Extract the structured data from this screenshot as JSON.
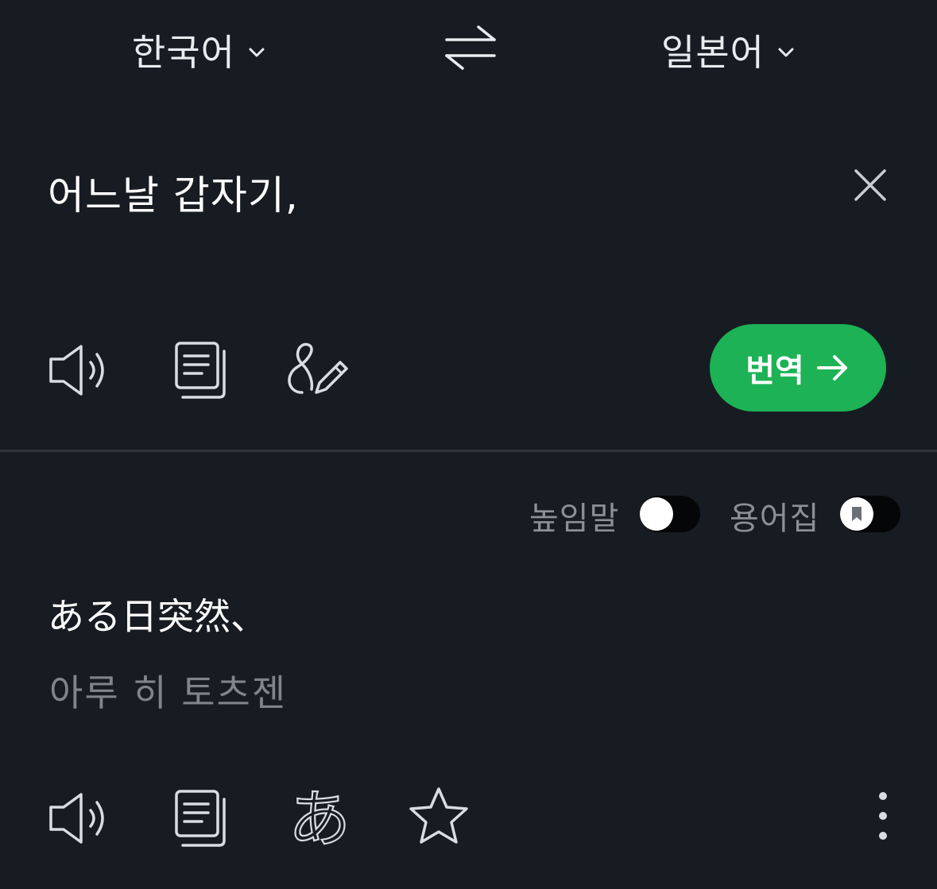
{
  "header": {
    "source_lang": "한국어",
    "target_lang": "일본어"
  },
  "input": {
    "text": "어느날 갑자기,"
  },
  "actions": {
    "translate_label": "번역"
  },
  "options": {
    "honorific_label": "높임말",
    "honorific_on": false,
    "glossary_label": "용어집",
    "glossary_on": false
  },
  "output": {
    "text": "ある日突然、",
    "pronunciation": "아루 히 토츠젠",
    "kana_glyph": "あ"
  },
  "colors": {
    "background": "#171c22",
    "accent": "#1db255",
    "muted_text": "#80858b",
    "divider": "#2e353d"
  }
}
